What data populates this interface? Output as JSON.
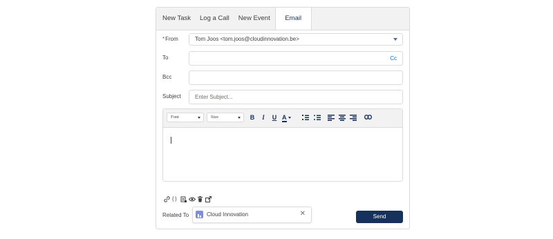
{
  "tabs": [
    {
      "label": "New Task"
    },
    {
      "label": "Log a Call"
    },
    {
      "label": "New Event"
    },
    {
      "label": "Email",
      "active": true
    }
  ],
  "form": {
    "from_label": "From",
    "from_required": "*",
    "from_value": "Tom Joos <tom.joos@cloudinnovation.be>",
    "to_label": "To",
    "to_value": "",
    "cc_label": "Cc",
    "bcc_label": "Bcc",
    "bcc_value": "",
    "subject_label": "Subject",
    "subject_placeholder": "Enter Subject..."
  },
  "toolbar": {
    "font_label": "Font",
    "size_label": "Size",
    "bold": "B",
    "italic": "I",
    "underline": "U",
    "text_color": "A"
  },
  "footer_icons": [
    "link-icon",
    "merge-field-icon",
    "template-icon",
    "preview-icon",
    "delete-icon",
    "popout-icon"
  ],
  "related": {
    "label": "Related To",
    "value": "Cloud Innovation"
  },
  "send_label": "Send",
  "colors": {
    "brand_dark": "#16325c",
    "link": "#0070d2",
    "account_icon": "#7f8de1",
    "border": "#dddbda",
    "tab_bg": "#f3f2f2"
  }
}
